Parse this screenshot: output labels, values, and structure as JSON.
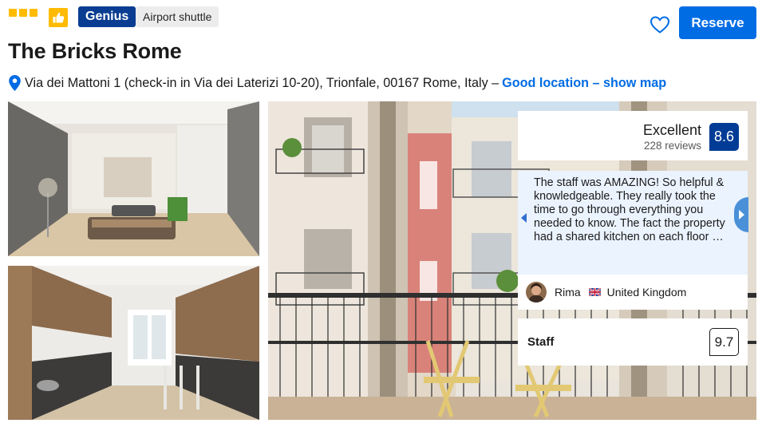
{
  "header": {
    "star_rating": 3,
    "star_icon": "square-star-icon",
    "thumbs_icon": "thumbs-up-icon",
    "genius_label": "Genius",
    "amenity_badge": "Airport shuttle",
    "reserve_label": "Reserve",
    "favorite_icon": "heart-outline-icon"
  },
  "hotel": {
    "name": "The Bricks Rome",
    "address": "Via dei Mattoni 1 (check-in in Via dei Laterizi 10-20), Trionfale, 00167 Rome, Italy –",
    "location_link": "Good location – show map"
  },
  "photos": [
    {
      "subject": "living-room-photo"
    },
    {
      "subject": "kitchen-photo"
    },
    {
      "subject": "balcony-photo"
    }
  ],
  "review_summary": {
    "label": "Excellent",
    "reviews_count": "228 reviews",
    "score": "8.6"
  },
  "featured_review": {
    "text": "The staff was AMAZING! So helpful & knowledgeable. They really took the time to go through everything you needed to know. The fact the property had a shared kitchen on each floor …",
    "reviewer_name": "Rima",
    "reviewer_country": "United Kingdom"
  },
  "category_score": {
    "label": "Staff",
    "score": "9.7"
  },
  "colors": {
    "brand_blue": "#006ce4",
    "genius_blue": "#0a3d91",
    "score_blue": "#003b95",
    "star_yellow": "#febb02",
    "review_bg": "#ebf3ff"
  }
}
